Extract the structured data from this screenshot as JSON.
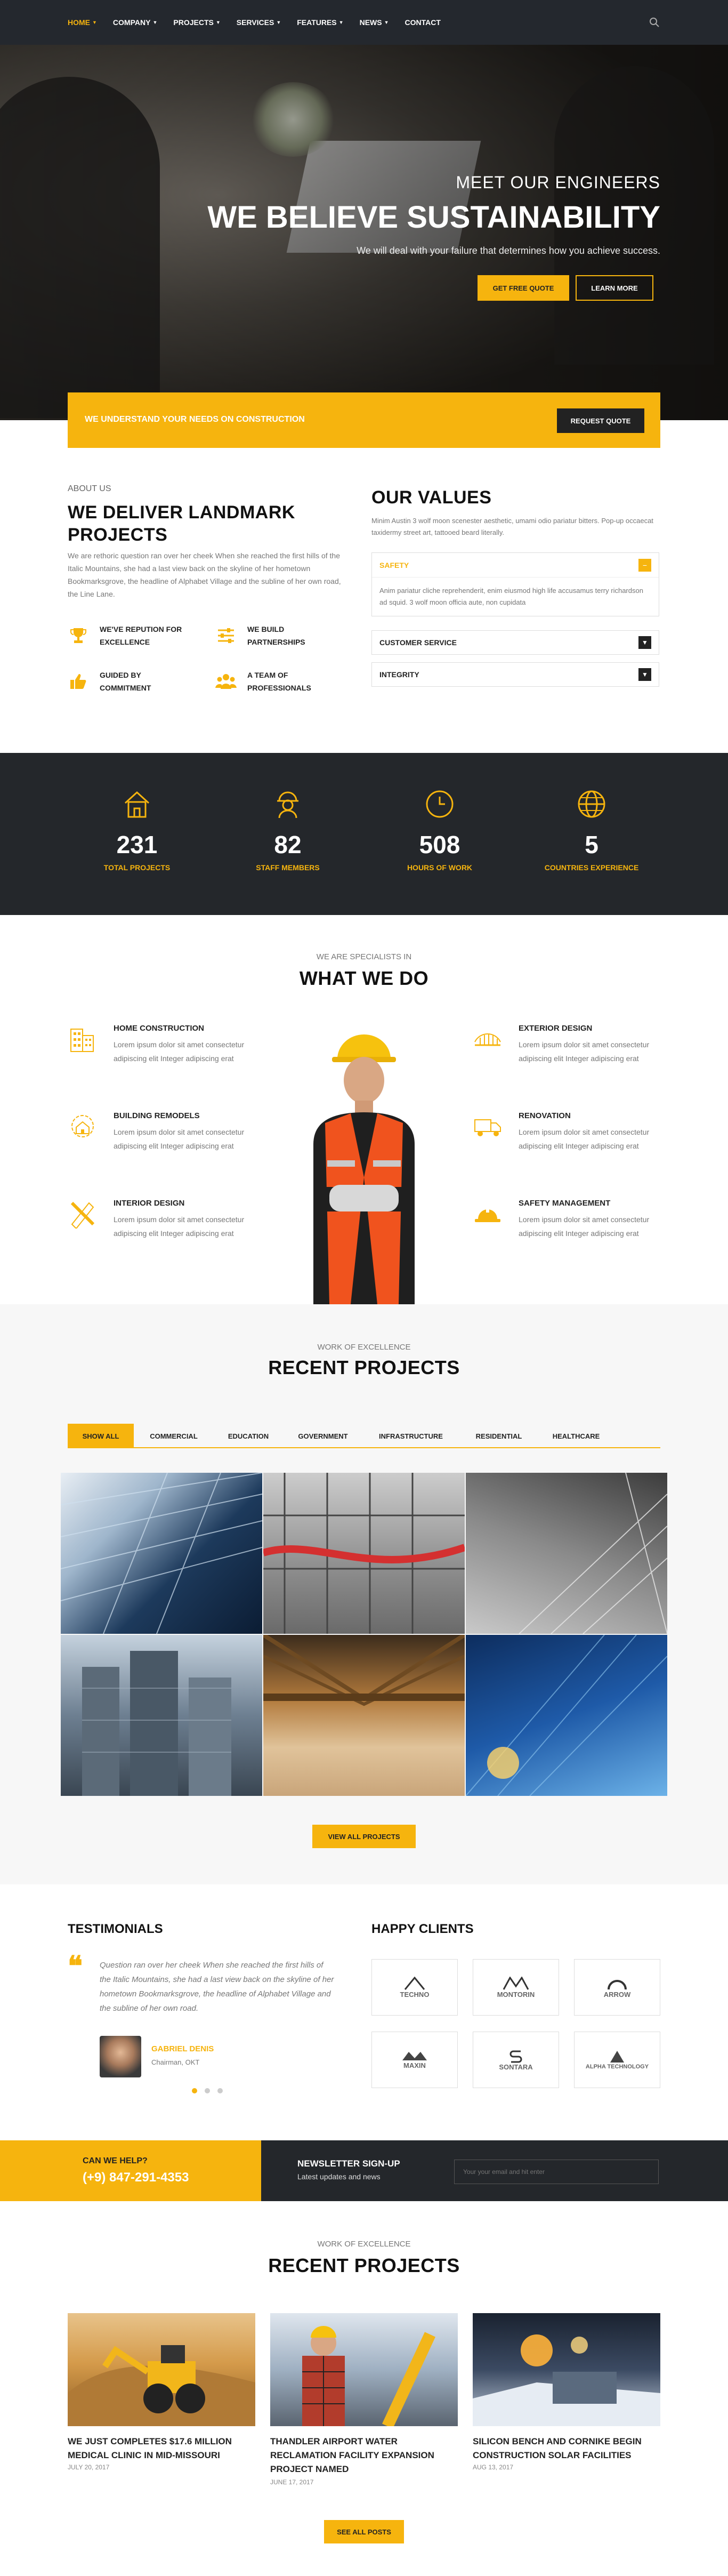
{
  "nav": {
    "items": [
      {
        "label": "HOME",
        "active": true
      },
      {
        "label": "COMPANY",
        "active": false
      },
      {
        "label": "PROJECTS",
        "active": false
      },
      {
        "label": "SERVICES",
        "active": false
      },
      {
        "label": "FEATURES",
        "active": false
      },
      {
        "label": "NEWS",
        "active": false
      },
      {
        "label": "CONTACT",
        "active": false
      }
    ],
    "search_icon": "search-icon"
  },
  "hero": {
    "kicker": "MEET OUR ENGINEERS",
    "title": "WE BELIEVE SUSTAINABILITY",
    "subtitle": "We will deal with your failure that determines how you achieve success.",
    "btn_quote": "GET FREE QUOTE",
    "btn_more": "LEARN MORE"
  },
  "request_bar": {
    "text": "WE UNDERSTAND YOUR NEEDS ON CONSTRUCTION",
    "button": "REQUEST QUOTE"
  },
  "about": {
    "kicker": "ABOUT US",
    "title_line1": "WE DELIVER LANDMARK",
    "title_line2": "PROJECTS",
    "text": "We are rethoric question ran over her cheek When she reached the first hills of the Italic Mountains, she had a last view back on the skyline of her hometown Bookmarksgrove, the headline of Alphabet Village and the subline of her own road, the Line Lane.",
    "features": [
      {
        "l1": "WE'VE REPUTION FOR",
        "l2": "EXCELLENCE",
        "icon": "trophy-icon"
      },
      {
        "l1": "WE BUILD",
        "l2": "PARTNERSHIPS",
        "icon": "sliders-icon"
      },
      {
        "l1": "GUIDED BY",
        "l2": "COMMITMENT",
        "icon": "thumbs-up-icon"
      },
      {
        "l1": "A TEAM OF",
        "l2": "PROFESSIONALS",
        "icon": "team-icon"
      }
    ]
  },
  "values": {
    "title": "OUR VALUES",
    "text": "Minim Austin 3 wolf moon scenester aesthetic, umami odio pariatur bitters. Pop-up occaecat taxidermy street art, tattooed beard literally.",
    "accordion": [
      {
        "label": "SAFETY",
        "open": true,
        "body": "Anim pariatur cliche reprehenderit, enim eiusmod high life accusamus terry richardson ad squid. 3 wolf moon officia aute, non cupidata"
      },
      {
        "label": "CUSTOMER SERVICE",
        "open": false
      },
      {
        "label": "INTEGRITY",
        "open": false
      }
    ]
  },
  "stats": [
    {
      "num": "231",
      "label": "TOTAL PROJECTS",
      "icon": "house-icon"
    },
    {
      "num": "82",
      "label": "STAFF MEMBERS",
      "icon": "worker-icon"
    },
    {
      "num": "508",
      "label": "HOURS OF WORK",
      "icon": "clock-icon"
    },
    {
      "num": "5",
      "label": "COUNTRIES EXPERIENCE",
      "icon": "globe-icon"
    }
  ],
  "services": {
    "kicker": "WE ARE SPECIALISTS IN",
    "title": "WHAT WE DO",
    "desc": "Lorem ipsum dolor sit amet consectetur adipiscing elit Integer adipiscing erat",
    "left": [
      {
        "title": "HOME CONSTRUCTION",
        "icon": "building-icon"
      },
      {
        "title": "BUILDING REMODELS",
        "icon": "gear-house-icon"
      },
      {
        "title": "INTERIOR DESIGN",
        "icon": "pencil-ruler-icon"
      }
    ],
    "right": [
      {
        "title": "EXTERIOR DESIGN",
        "icon": "bridge-icon"
      },
      {
        "title": "RENOVATION",
        "icon": "truck-icon"
      },
      {
        "title": "SAFETY MANAGEMENT",
        "icon": "helmet-icon"
      }
    ]
  },
  "projects": {
    "kicker": "WORK OF EXCELLENCE",
    "title": "RECENT PROJECTS",
    "tabs": [
      "SHOW ALL",
      "COMMERCIAL",
      "EDUCATION",
      "GOVERNMENT",
      "INFRASTRUCTURE",
      "RESIDENTIAL",
      "HEALTHCARE"
    ],
    "button": "VIEW ALL PROJECTS"
  },
  "testimonials": {
    "title": "TESTIMONIALS",
    "quote": "Question ran over her cheek When she reached the first hills of the Italic Mountains, she had a last view back on the skyline of her hometown Bookmarksgrove, the headline of Alphabet Village and the subline of her own road.",
    "name": "GABRIEL DENIS",
    "role": "Chairman, OKT"
  },
  "clients": {
    "title": "HAPPY CLIENTS",
    "logos": [
      "TECHNO",
      "MONTORIN",
      "ARROW",
      "MAXIN",
      "SONTARA",
      "ALPHA TECHNOLOGY"
    ]
  },
  "help": {
    "label": "CAN WE HELP?",
    "phone": "(+9) 847-291-4353"
  },
  "newsletter": {
    "title": "NEWSLETTER SIGN-UP",
    "sub": "Latest updates and news",
    "placeholder": "Your your email and hit enter"
  },
  "posts": {
    "kicker": "WORK OF EXCELLENCE",
    "title": "RECENT PROJECTS",
    "items": [
      {
        "title": "WE JUST COMPLETES $17.6 MILLION MEDICAL CLINIC IN MID-MISSOURI",
        "date": "JULY 20, 2017"
      },
      {
        "title": "THANDLER AIRPORT WATER RECLAMATION FACILITY EXPANSION PROJECT NAMED",
        "date": "JUNE 17, 2017"
      },
      {
        "title": "SILICON BENCH AND CORNIKE BEGIN CONSTRUCTION SOLAR FACILITIES",
        "date": "AUG 13, 2017"
      }
    ],
    "button": "SEE ALL POSTS"
  },
  "colors": {
    "accent": "#f6b40e",
    "dark": "#24272b"
  }
}
